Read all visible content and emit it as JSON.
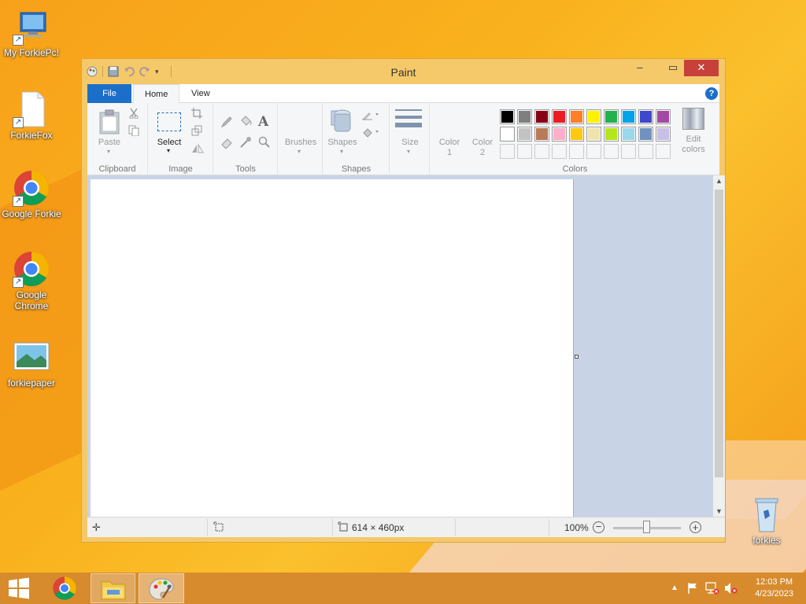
{
  "desktop": {
    "icons": [
      {
        "label": "My ForkiePc!",
        "icon": "computer-icon"
      },
      {
        "label": "ForkieFox",
        "icon": "file-icon"
      },
      {
        "label": "Google Forkie",
        "icon": "chrome-icon"
      },
      {
        "label": "Google Chrome",
        "icon": "chrome-icon"
      },
      {
        "label": "forkiepaper",
        "icon": "image-icon"
      },
      {
        "label": "forkies",
        "icon": "recycle-bin-icon"
      }
    ]
  },
  "window": {
    "title": "Paint",
    "tabs": {
      "file": "File",
      "home": "Home",
      "view": "View"
    },
    "help": "?",
    "ribbon": {
      "clipboard": {
        "paste": "Paste",
        "label": "Clipboard"
      },
      "image": {
        "select": "Select",
        "label": "Image"
      },
      "tools": {
        "label": "Tools"
      },
      "brushes": {
        "label": "Brushes"
      },
      "shapes": {
        "shapes": "Shapes",
        "label": "Shapes"
      },
      "size": {
        "label": "Size"
      },
      "color1": {
        "line1": "Color",
        "line2": "1"
      },
      "color2": {
        "line1": "Color",
        "line2": "2"
      },
      "colors": {
        "label": "Colors",
        "edit_line1": "Edit",
        "edit_line2": "colors",
        "row1": [
          "#000000",
          "#7f7f7f",
          "#880015",
          "#ed1c24",
          "#ff7f27",
          "#fff200",
          "#22b14c",
          "#00a2e8",
          "#3f48cc",
          "#a349a4"
        ],
        "row2": [
          "#ffffff",
          "#c3c3c3",
          "#b97a57",
          "#ffaec9",
          "#ffc90e",
          "#efe4b0",
          "#b5e61d",
          "#99d9ea",
          "#7092be",
          "#c8bfe7"
        ],
        "row3": [
          "#f4f6f8",
          "#f4f6f8",
          "#f4f6f8",
          "#f4f6f8",
          "#f4f6f8",
          "#f4f6f8",
          "#f4f6f8",
          "#f4f6f8",
          "#f4f6f8",
          "#f4f6f8"
        ]
      }
    },
    "status": {
      "dimensions": "614 × 460px",
      "zoom": "100%"
    }
  },
  "taskbar": {
    "time": "12:03 PM",
    "date": "4/23/2023"
  }
}
